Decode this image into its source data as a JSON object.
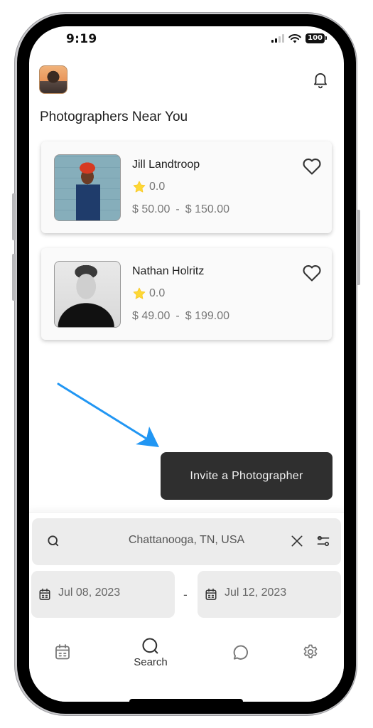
{
  "status_bar": {
    "time": "9:19",
    "battery": "100"
  },
  "header": {
    "avatar_icon": "user-avatar",
    "notification_icon": "bell-icon",
    "title": "Photographers Near You"
  },
  "photographers": [
    {
      "name": "Jill Landtroop",
      "rating": "0.0",
      "price_min": "$ 50.00",
      "price_separator": "-",
      "price_max": "$ 150.00",
      "favorite_icon": "heart-outline-icon"
    },
    {
      "name": "Nathan Holritz",
      "rating": "0.0",
      "price_min": "$ 49.00",
      "price_separator": "-",
      "price_max": "$ 199.00",
      "favorite_icon": "heart-outline-icon"
    }
  ],
  "annotation": {
    "arrow_color": "#2196f3"
  },
  "invite_button": {
    "label": "Invite a Photographer"
  },
  "search": {
    "value": "Chattanooga, TN, USA",
    "search_icon": "search-icon",
    "clear_icon": "close-icon",
    "filter_icon": "sliders-icon"
  },
  "date_range": {
    "start": "Jul 08, 2023",
    "separator": "-",
    "end": "Jul 12, 2023"
  },
  "tab_bar": {
    "tabs": [
      {
        "id": "calendar",
        "icon": "calendar-icon",
        "label": ""
      },
      {
        "id": "search",
        "icon": "search-icon",
        "label": "Search",
        "active": true
      },
      {
        "id": "messages",
        "icon": "chat-bubble-icon",
        "label": ""
      },
      {
        "id": "settings",
        "icon": "gear-icon",
        "label": ""
      }
    ]
  },
  "colors": {
    "invite_button_bg": "#2f2f2f",
    "star": "#fdd835",
    "card_bg": "#fafafa",
    "input_bg": "#ececec"
  }
}
